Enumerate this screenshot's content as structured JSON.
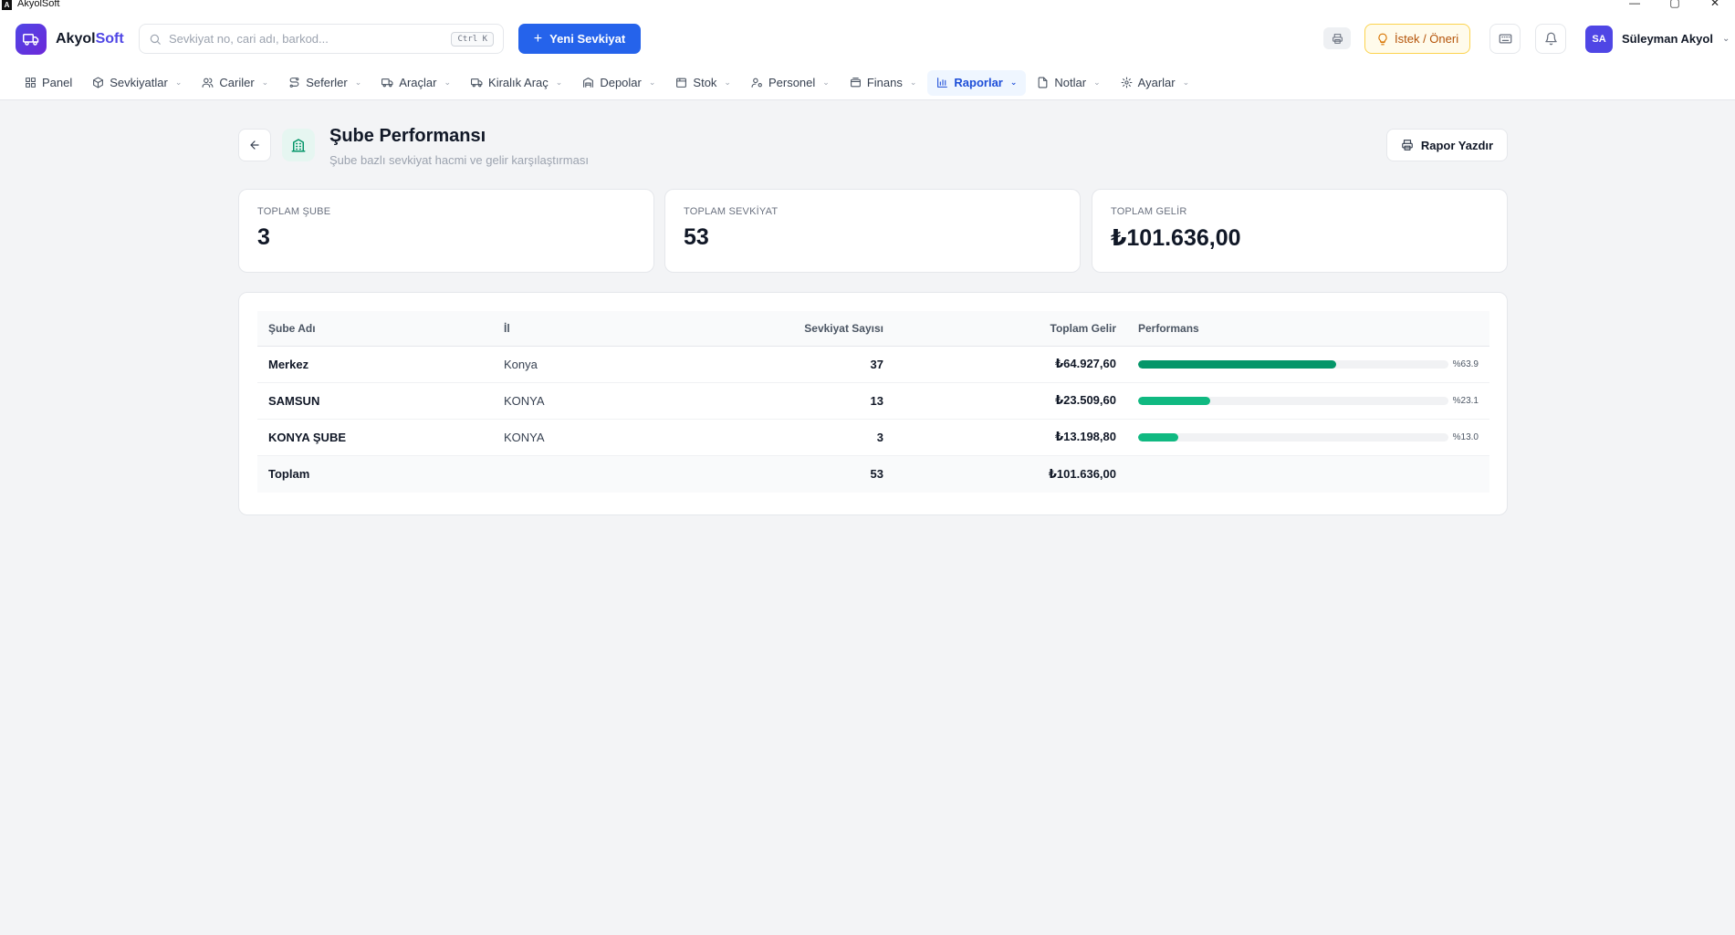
{
  "os": {
    "title": "AkyolSoft",
    "minimize": "—",
    "maximize": "▢",
    "close": "✕"
  },
  "header": {
    "brand_main": "Akyol",
    "brand_accent": "Soft",
    "search_placeholder": "Sevkiyat no, cari adı, barkod...",
    "search_shortcut": "Ctrl K",
    "new_button": "Yeni Sevkiyat",
    "suggest_button": "İstek / Öneri",
    "user_initials": "SA",
    "user_name": "Süleyman Akyol"
  },
  "nav": [
    {
      "label": "Panel",
      "icon": "grid-icon",
      "has_menu": false,
      "active": false
    },
    {
      "label": "Sevkiyatlar",
      "icon": "package-icon",
      "has_menu": true,
      "active": false
    },
    {
      "label": "Cariler",
      "icon": "users-icon",
      "has_menu": true,
      "active": false
    },
    {
      "label": "Seferler",
      "icon": "route-icon",
      "has_menu": true,
      "active": false
    },
    {
      "label": "Araçlar",
      "icon": "truck-icon",
      "has_menu": true,
      "active": false
    },
    {
      "label": "Kiralık Araç",
      "icon": "truck-icon",
      "has_menu": true,
      "active": false
    },
    {
      "label": "Depolar",
      "icon": "warehouse-icon",
      "has_menu": true,
      "active": false
    },
    {
      "label": "Stok",
      "icon": "box-icon",
      "has_menu": true,
      "active": false
    },
    {
      "label": "Personel",
      "icon": "user-cog-icon",
      "has_menu": true,
      "active": false
    },
    {
      "label": "Finans",
      "icon": "wallet-icon",
      "has_menu": true,
      "active": false
    },
    {
      "label": "Raporlar",
      "icon": "bar-chart-icon",
      "has_menu": true,
      "active": true
    },
    {
      "label": "Notlar",
      "icon": "file-icon",
      "has_menu": true,
      "active": false
    },
    {
      "label": "Ayarlar",
      "icon": "gear-icon",
      "has_menu": true,
      "active": false
    }
  ],
  "page": {
    "title": "Şube Performansı",
    "subtitle": "Şube bazlı sevkiyat hacmi ve gelir karşılaştırması",
    "print_button": "Rapor Yazdır"
  },
  "stats": [
    {
      "label": "TOPLAM ŞUBE",
      "value": "3"
    },
    {
      "label": "TOPLAM SEVKİYAT",
      "value": "53"
    },
    {
      "label": "TOPLAM GELİR",
      "value": "₺101.636,00"
    }
  ],
  "table": {
    "headers": {
      "name": "Şube Adı",
      "city": "İl",
      "count": "Sevkiyat Sayısı",
      "revenue": "Toplam Gelir",
      "performance": "Performans"
    },
    "rows": [
      {
        "name": "Merkez",
        "city": "Konya",
        "count": "37",
        "revenue": "₺64.927,60",
        "percent_label": "%63.9",
        "percent": 63.9
      },
      {
        "name": "SAMSUN",
        "city": "KONYA",
        "count": "13",
        "revenue": "₺23.509,60",
        "percent_label": "%23.1",
        "percent": 23.1
      },
      {
        "name": "KONYA ŞUBE",
        "city": "KONYA",
        "count": "3",
        "revenue": "₺13.198,80",
        "percent_label": "%13.0",
        "percent": 13.0
      }
    ],
    "total": {
      "label": "Toplam",
      "count": "53",
      "revenue": "₺101.636,00"
    }
  },
  "colors": {
    "primary": "#2563eb",
    "brand": "#4f46e5",
    "accent_green": "#10b981",
    "accent_green_dark": "#059669"
  }
}
